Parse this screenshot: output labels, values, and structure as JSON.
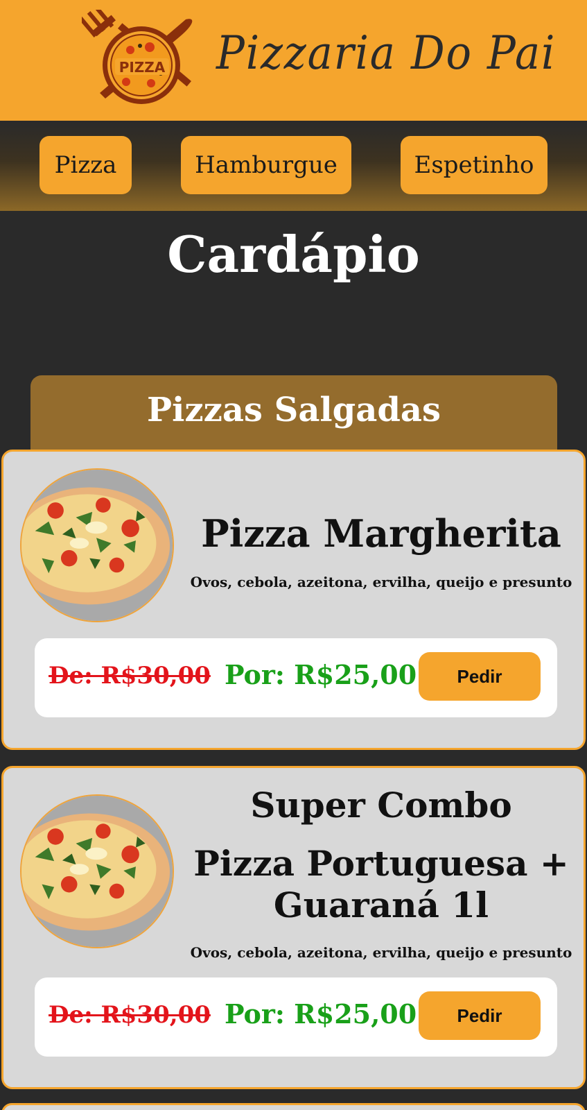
{
  "header": {
    "logo_text": "PIZZA",
    "brand_name": "Pizzaria Do Pai"
  },
  "nav": {
    "items": [
      {
        "label": "Pizza"
      },
      {
        "label": "Hamburgue"
      },
      {
        "label": "Espetinho"
      }
    ]
  },
  "main": {
    "title": "Cardápio",
    "section_title": "Pizzas Salgadas",
    "items": [
      {
        "name": "Pizza Margherita",
        "description": "Ovos, cebola, azeitona, ervilha, queijo e presunto",
        "old_price": "De: R$30,00",
        "new_price": "Por: R$25,00",
        "button_label": "Pedir"
      },
      {
        "name_line1": "Super Combo",
        "name_line2": "Pizza Portuguesa +",
        "name_line3": "Guaraná 1l",
        "description": "Ovos, cebola, azeitona, ervilha, queijo e presunto",
        "old_price": "De: R$30,00",
        "new_price": "Por: R$25,00",
        "button_label": "Pedir"
      }
    ]
  },
  "colors": {
    "accent": "#f5a52d",
    "background": "#2a2a2a",
    "section_header": "#946c2d",
    "old_price": "#e3141b",
    "new_price": "#19a019"
  }
}
